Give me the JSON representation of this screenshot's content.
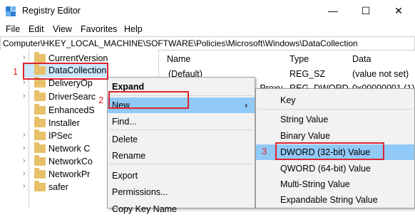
{
  "window": {
    "title": "Registry Editor",
    "controls": {
      "minimize": "—",
      "maximize": "☐",
      "close": "✕"
    }
  },
  "menubar": [
    "File",
    "Edit",
    "View",
    "Favorites",
    "Help"
  ],
  "address": "Computer\\HKEY_LOCAL_MACHINE\\SOFTWARE\\Policies\\Microsoft\\Windows\\DataCollection",
  "tree": {
    "items": [
      {
        "label": "CurrentVersion"
      },
      {
        "label": "DataCollection"
      },
      {
        "label": "DeliveryOp"
      },
      {
        "label": "DriverSearc"
      },
      {
        "label": "EnhancedS"
      },
      {
        "label": "Installer"
      },
      {
        "label": "IPSec"
      },
      {
        "label": "Network C"
      },
      {
        "label": "NetworkCo"
      },
      {
        "label": "NetworkPr"
      },
      {
        "label": "safer"
      }
    ]
  },
  "values_pane": {
    "headers": {
      "name": "Name",
      "type": "Type",
      "data": "Data"
    },
    "rows": [
      {
        "name": "(Default)",
        "type": "REG_SZ",
        "data": "(value not set)"
      },
      {
        "name": "...Proxy",
        "type": "REG_DWORD",
        "data": "0x00000001 (1)"
      }
    ]
  },
  "context_menu": {
    "items": [
      "Expand",
      "New",
      "Find...",
      "Delete",
      "Rename",
      "Export",
      "Permissions...",
      "Copy Key Name"
    ],
    "submenu_arrow": "›"
  },
  "new_submenu": {
    "items": [
      "Key",
      "String Value",
      "Binary Value",
      "DWORD (32-bit) Value",
      "QWORD (64-bit) Value",
      "Multi-String Value",
      "Expandable String Value"
    ]
  },
  "annotations": {
    "step1": "1",
    "step2": "2",
    "step3": "3"
  },
  "colors": {
    "highlight": "#91c9f7",
    "selection": "#cce8ff",
    "annotation_red": "#e0232e",
    "folder": "#e8c06a"
  }
}
